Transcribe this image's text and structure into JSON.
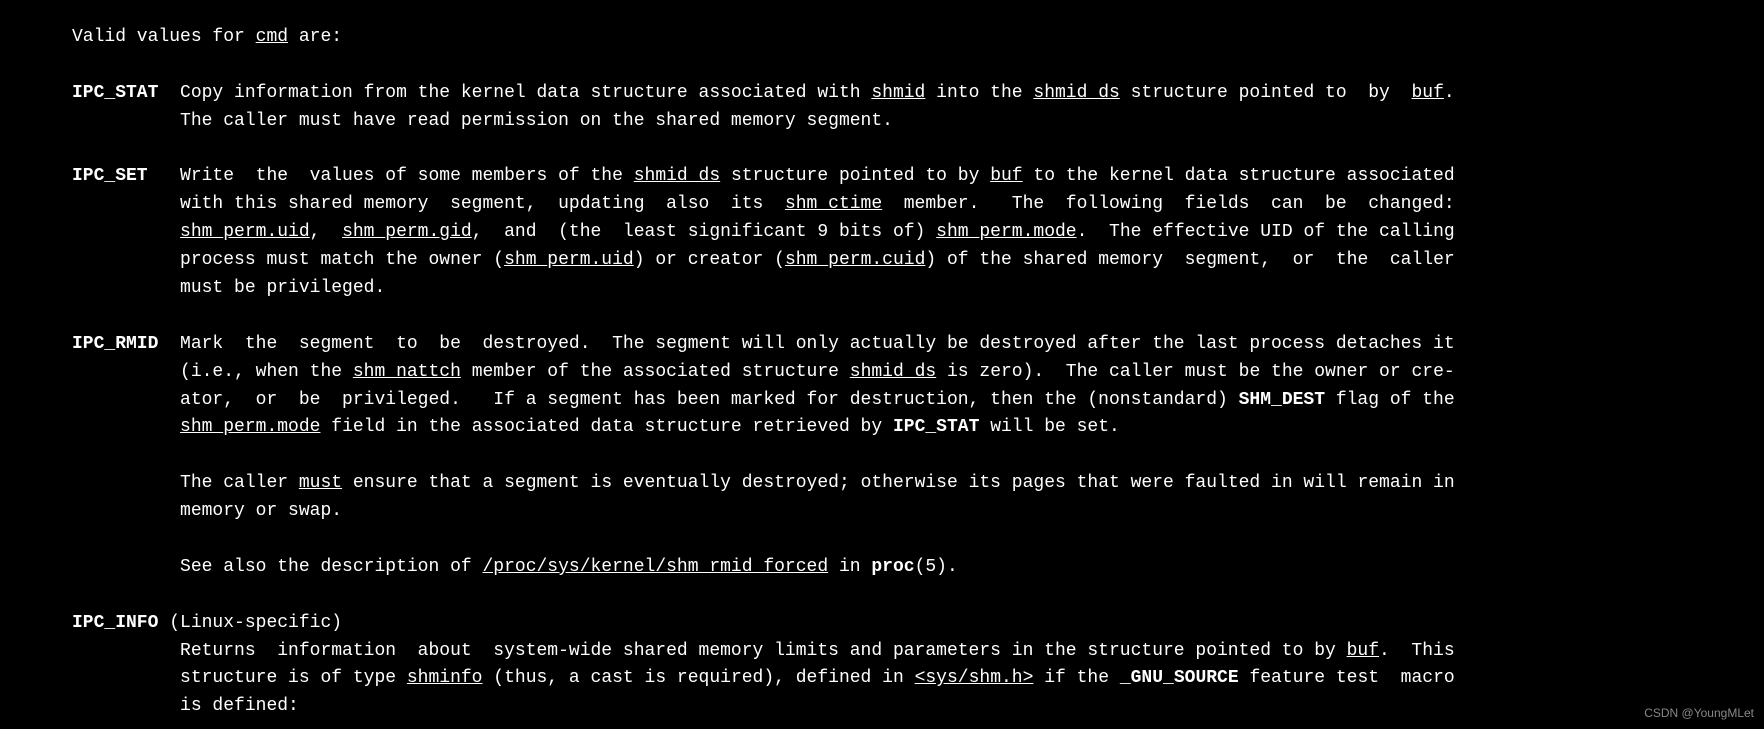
{
  "intro": {
    "prefix": "Valid values for ",
    "cmd": "cmd",
    "suffix": " are:"
  },
  "entries": {
    "ipc_stat": {
      "tag": "IPC_STAT",
      "t1": "Copy information from the kernel data structure associated with ",
      "shmid": "shmid",
      "t2": " into the ",
      "shmid_ds": "shmid_ds",
      "t3": " structure pointed to  by  ",
      "buf": "buf",
      "t4": ".",
      "line2": "The caller must have read permission on the shared memory segment."
    },
    "ipc_set": {
      "tag": "IPC_SET",
      "t1": "Write  the  values of some members of the ",
      "shmid_ds": "shmid_ds",
      "t2": " structure pointed to by ",
      "buf": "buf",
      "t3": " to the kernel data structure associated",
      "l2a": "with this shared memory  segment,  updating  also  its  ",
      "shm_ctime": "shm_ctime",
      "l2b": "  member.   The  following  fields  can  be  changed:",
      "uid": "shm_perm.uid",
      "sep1": ",  ",
      "gid": "shm_perm.gid",
      "sep2": ",  and  (the  least significant 9 bits of) ",
      "mode": "shm_perm.mode",
      "l3b": ".  The effective UID of the calling",
      "l4a": "process must match the owner (",
      "uid2": "shm_perm.uid",
      "l4b": ") or creator (",
      "cuid": "shm_perm.cuid",
      "l4c": ") of the shared memory  segment,  or  the  caller",
      "l5": "must be privileged."
    },
    "ipc_rmid": {
      "tag": "IPC_RMID",
      "t1": "Mark  the  segment  to  be  destroyed.  The segment will only actually be destroyed after the last process detaches it",
      "l2a": "(i.e., when the ",
      "nattch": "shm_nattch",
      "l2b": " member of the associated structure ",
      "shmid_ds": "shmid_ds",
      "l2c": " is zero).  The caller must be the owner or cre-",
      "l3a": "ator,  or  be  privileged.   If a segment has been marked for destruction, then the (nonstandard) ",
      "shm_dest": "SHM_DEST",
      "l3b": " flag of the",
      "mode": "shm_perm.mode",
      "l4b": " field in the associated data structure retrieved by ",
      "ipc_stat_ref": "IPC_STAT",
      "l4c": " will be set.",
      "p2a": "The caller ",
      "must": "must",
      "p2b": " ensure that a segment is eventually destroyed; otherwise its pages that were faulted in will remain in",
      "p2c": "memory or swap.",
      "p3a": "See also the description of ",
      "proc_path": "/proc/sys/kernel/shm_rmid_forced",
      "p3b": " in ",
      "proc": "proc",
      "p3c": "(5)."
    },
    "ipc_info": {
      "tag": "IPC_INFO",
      "linux": " (Linux-specific)",
      "l1a": "Returns  information  about  system-wide shared memory limits and parameters in the structure pointed to by ",
      "buf": "buf",
      "l1b": ".  This",
      "l2a": "structure is of type ",
      "shminfo": "shminfo",
      "l2b": " (thus, a cast is required), defined in ",
      "header": "<sys/shm.h>",
      "l2c": " if the ",
      "gnu": "_GNU_SOURCE",
      "l2d": " feature test  macro",
      "l3": "is defined:"
    }
  },
  "watermark": "CSDN @YoungMLet"
}
